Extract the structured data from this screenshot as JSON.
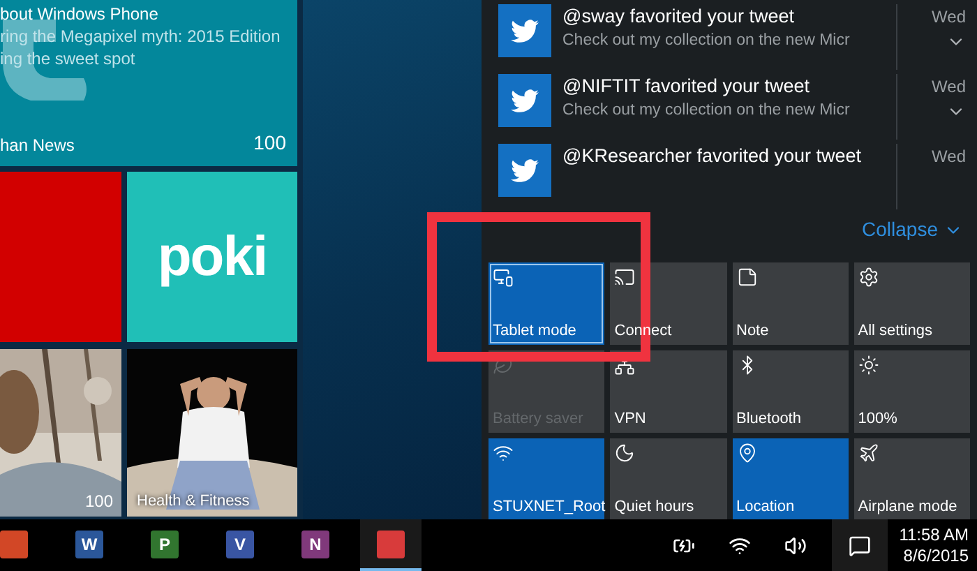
{
  "start_tiles": {
    "news_tile": {
      "lines": [
        "bout Windows Phone",
        "ring the Megapixel myth: 2015 Edition",
        "ing the sweet spot"
      ],
      "name": "han News",
      "badge": "100"
    },
    "poki_tile": {
      "logo": "poki"
    },
    "photo_tile": {
      "kind": "picture",
      "badge": "100"
    },
    "health_tile": {
      "kind": "picture",
      "name": "Health & Fitness"
    }
  },
  "notifications": [
    {
      "title": "@sway favorited your tweet",
      "body": "Check out my collection on the new Micr",
      "time": "Wed"
    },
    {
      "title": "@NIFTIT favorited your tweet",
      "body": "Check out my collection on the new Micr",
      "time": "Wed"
    },
    {
      "title": "@KResearcher favorited your tweet",
      "time": "Wed"
    }
  ],
  "collapse": "Collapse",
  "quick_actions": [
    {
      "label": "Tablet mode",
      "on": true,
      "disabled": false,
      "selected": true
    },
    {
      "label": "Connect",
      "on": false,
      "disabled": false,
      "selected": false
    },
    {
      "label": "Note",
      "on": false,
      "disabled": false,
      "selected": false
    },
    {
      "label": "All settings",
      "on": false,
      "disabled": false,
      "selected": false
    },
    {
      "label": "Battery saver",
      "on": false,
      "disabled": true,
      "selected": false
    },
    {
      "label": "VPN",
      "on": false,
      "disabled": false,
      "selected": false
    },
    {
      "label": "Bluetooth",
      "on": false,
      "disabled": false,
      "selected": false
    },
    {
      "label": "100%",
      "on": false,
      "disabled": false,
      "selected": false
    },
    {
      "label": "STUXNET_Root",
      "on": true,
      "disabled": false,
      "selected": false
    },
    {
      "label": "Quiet hours",
      "on": false,
      "disabled": false,
      "selected": false
    },
    {
      "label": "Location",
      "on": true,
      "disabled": false,
      "selected": false
    },
    {
      "label": "Airplane mode",
      "on": false,
      "disabled": false,
      "selected": false
    }
  ],
  "taskbar": {
    "apps": [
      {
        "color": "#d24726",
        "selected": false
      },
      {
        "color": "#2b579a",
        "glyph": "W",
        "selected": false
      },
      {
        "color": "#31752f",
        "glyph": "P",
        "selected": false
      },
      {
        "color": "#3955a3",
        "glyph": "V",
        "selected": false
      },
      {
        "color": "#80397b",
        "glyph": "N",
        "selected": false
      },
      {
        "color": "#d83b3b",
        "selected": true
      }
    ],
    "time": "11:58 AM",
    "date": "8/6/2015"
  }
}
